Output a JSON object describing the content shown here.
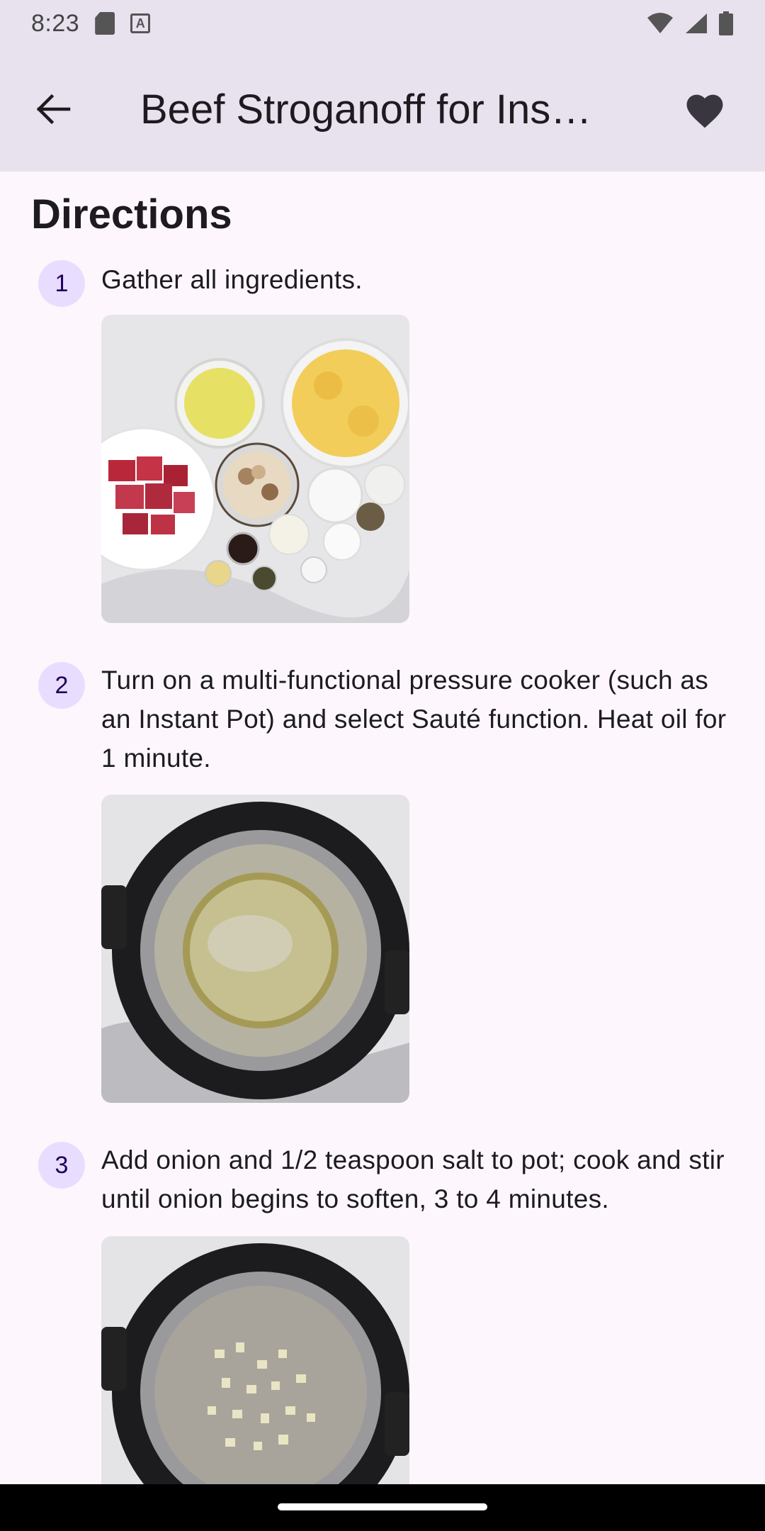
{
  "status": {
    "time": "8:23"
  },
  "appbar": {
    "title": "Beef Stroganoff for Ins…"
  },
  "section": {
    "title": "Directions"
  },
  "steps": [
    {
      "num": "1",
      "text": "Gather all ingredients."
    },
    {
      "num": "2",
      "text": "Turn on a multi-functional pressure cooker (such as an Instant Pot) and select Sauté function. Heat oil for 1 minute."
    },
    {
      "num": "3",
      "text": "Add onion and 1/2 teaspoon salt to pot; cook and stir until onion begins to soften, 3 to 4 minutes."
    }
  ],
  "icons": {
    "back": "arrow-back-icon",
    "favorite": "heart-icon"
  },
  "colors": {
    "appbar_bg": "#e8e1ee",
    "page_bg": "#fdf7fd",
    "step_badge_bg": "#e9ddff",
    "step_badge_fg": "#21005d"
  }
}
